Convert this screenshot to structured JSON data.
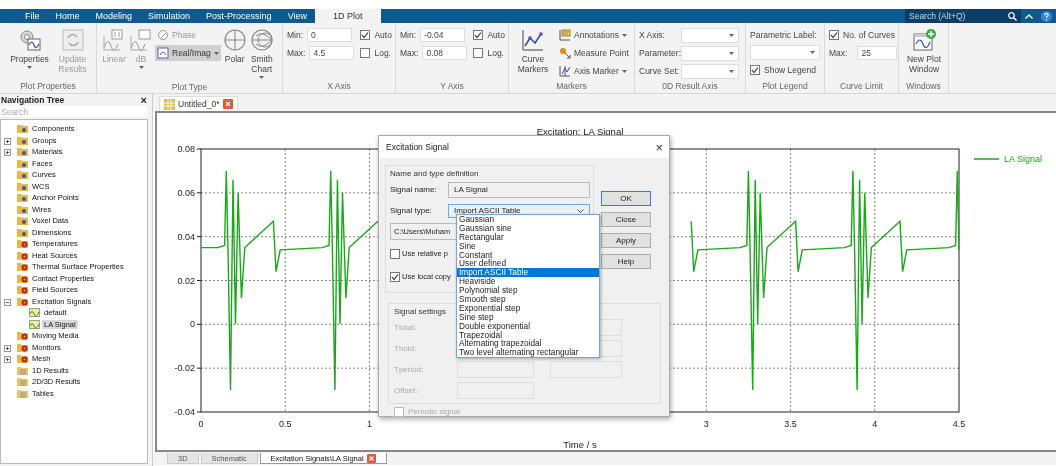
{
  "menu_tabs": [
    {
      "label": "File",
      "selected": false
    },
    {
      "label": "Home",
      "selected": false
    },
    {
      "label": "Modeling",
      "selected": false
    },
    {
      "label": "Simulation",
      "selected": false
    },
    {
      "label": "Post-Processing",
      "selected": false
    },
    {
      "label": "View",
      "selected": false
    },
    {
      "label": "1D Plot",
      "selected": true
    }
  ],
  "search": {
    "placeholder": "Search (Alt+Q)"
  },
  "ribbon": {
    "plot_properties": {
      "label": "Plot Properties",
      "buttons": [
        {
          "label": "Properties",
          "disabled": false,
          "menu": true
        },
        {
          "label": "Update Results",
          "disabled": true,
          "menu": false
        }
      ]
    },
    "plot_type": {
      "label": "Plot Type",
      "buttons": [
        {
          "kind": "large",
          "label": "Linear",
          "selected": false,
          "menu": false
        },
        {
          "kind": "large",
          "label": "dB",
          "selected": false,
          "menu": true
        },
        {
          "kind": "small",
          "label": "Phase",
          "selected": false,
          "menu": false
        },
        {
          "kind": "small",
          "label": "Real/Imag",
          "selected": true,
          "menu": true
        },
        {
          "kind": "large",
          "label": "Polar",
          "selected": false,
          "menu": false
        },
        {
          "kind": "large",
          "label": "Smith Chart",
          "selected": false,
          "menu": true
        }
      ]
    },
    "x_axis": {
      "label": "X Axis",
      "min_label": "Min:",
      "min": "0",
      "max_label": "Max:",
      "max": "4.5",
      "auto": {
        "label": "Auto",
        "checked": true
      },
      "log": {
        "label": "Log.",
        "checked": false
      }
    },
    "y_axis": {
      "label": "Y Axis",
      "min_label": "Min:",
      "min": "-0.04",
      "max_label": "Max:",
      "max": "0.08",
      "auto": {
        "label": "Auto",
        "checked": true
      },
      "log": {
        "label": "Log.",
        "checked": false
      }
    },
    "markers": {
      "label": "Markers",
      "curve_markers": "Curve Markers",
      "items": [
        {
          "label": "Annotations",
          "menu": true
        },
        {
          "label": "Measure Point",
          "menu": false
        },
        {
          "label": "Axis Marker",
          "menu": true
        }
      ]
    },
    "result_axis": {
      "label": "0D Result Axis",
      "fields": [
        "X Axis:",
        "Parameter:",
        "Curve Set:"
      ]
    },
    "plot_legend": {
      "label": "Plot Legend",
      "parametric_label": "Parametric Label:",
      "show_legend": {
        "label": "Show Legend",
        "checked": true
      }
    },
    "curve_limit": {
      "label": "Curve Limit",
      "no_of_curves": {
        "label": "No. of Curves",
        "checked": true
      },
      "max_label": "Max:",
      "max": "25"
    },
    "windows": {
      "label": "Windows",
      "new_plot": "New Plot Window"
    }
  },
  "navigation": {
    "title": "Navigation Tree",
    "close": "×",
    "search_placeholder": "Search",
    "tree": [
      {
        "label": "Components",
        "kind": "folder",
        "selected": false
      },
      {
        "label": "Groups",
        "kind": "folder",
        "expanded": false,
        "selected": false
      },
      {
        "label": "Materials",
        "kind": "folder",
        "expanded": false,
        "selected": false
      },
      {
        "label": "Faces",
        "kind": "folder",
        "selected": false
      },
      {
        "label": "Curves",
        "kind": "folder",
        "selected": false
      },
      {
        "label": "WCS",
        "kind": "folder",
        "selected": false
      },
      {
        "label": "Anchor Points",
        "kind": "folder",
        "selected": false
      },
      {
        "label": "Wires",
        "kind": "folder",
        "selected": false
      },
      {
        "label": "Voxel Data",
        "kind": "folder",
        "selected": false
      },
      {
        "label": "Dimensions",
        "kind": "folder",
        "selected": false
      },
      {
        "label": "Temperatures",
        "kind": "gear-folder",
        "selected": false
      },
      {
        "label": "Heat Sources",
        "kind": "gear-folder",
        "selected": false
      },
      {
        "label": "Thermal Surface Properties",
        "kind": "gear-folder",
        "selected": false
      },
      {
        "label": "Contact Properties",
        "kind": "gear-folder",
        "selected": false
      },
      {
        "label": "Field Sources",
        "kind": "gear-folder",
        "selected": false
      },
      {
        "label": "Excitation Signals",
        "kind": "gear-folder",
        "expanded": true,
        "selected": false,
        "children": [
          {
            "label": "default",
            "kind": "signal",
            "selected": false
          },
          {
            "label": "LA Signal",
            "kind": "signal",
            "selected": true
          }
        ]
      },
      {
        "label": "Moving Media",
        "kind": "gear-folder",
        "selected": false
      },
      {
        "label": "Monitors",
        "kind": "gear-folder",
        "expanded": false,
        "selected": false
      },
      {
        "label": "Mesh",
        "kind": "gear-folder",
        "expanded": false,
        "selected": false
      },
      {
        "label": "1D Results",
        "kind": "results",
        "selected": false
      },
      {
        "label": "2D/3D Results",
        "kind": "results",
        "selected": false
      },
      {
        "label": "Tables",
        "kind": "results",
        "selected": false
      }
    ]
  },
  "document_tabs": [
    {
      "label": "Untitled_0*",
      "selected": true
    }
  ],
  "plot": {
    "chart_data": {
      "type": "line",
      "title": "Excitation: LA Signal",
      "xlabel": "Time / s",
      "xlim": [
        0,
        4.5
      ],
      "ylim": [
        -0.04,
        0.08
      ],
      "xticks": [
        0,
        0.5,
        1,
        3,
        3.5,
        4,
        4.5
      ],
      "yticks": [
        0.08,
        0.06,
        0.04,
        0.02,
        0,
        -0.02,
        -0.04
      ],
      "x": [
        0,
        0.1,
        0.14,
        0.15,
        0.16,
        0.175,
        0.19,
        0.205,
        0.22,
        0.24,
        0.26,
        0.43,
        0.445,
        0.47,
        0.72,
        0.76,
        0.77,
        0.78,
        0.795,
        0.81,
        0.825,
        0.84,
        0.86,
        0.88,
        1.05,
        1.065,
        1.09,
        1.34,
        1.38,
        1.39,
        1.4,
        1.415,
        1.43,
        1.445,
        1.46,
        1.48,
        1.5,
        1.67,
        1.685,
        1.71,
        1.96,
        2.0,
        2.01,
        2.02,
        2.035,
        2.05,
        2.065,
        2.08,
        2.1,
        2.12,
        2.29,
        2.305,
        2.33,
        2.58,
        2.62,
        2.63,
        2.64,
        2.655,
        2.67,
        2.685,
        2.7,
        2.72,
        2.74,
        2.91,
        2.925,
        2.95,
        3.2,
        3.24,
        3.25,
        3.26,
        3.275,
        3.29,
        3.305,
        3.32,
        3.34,
        3.36,
        3.53,
        3.545,
        3.57,
        3.82,
        3.86,
        3.87,
        3.88,
        3.895,
        3.91,
        3.925,
        3.94,
        3.96,
        3.98,
        4.15,
        4.165,
        4.19,
        4.44,
        4.48,
        4.49,
        4.5
      ],
      "series": [
        {
          "name": "LA Signal",
          "color": "#1aa81a",
          "values": [
            0.035,
            0.035,
            0.036,
            0.07,
            0.034,
            -0.03,
            0.066,
            0,
            0.06,
            0.012,
            0.035,
            0.047,
            0.024,
            0.034,
            0.035,
            0.036,
            0.07,
            0.034,
            -0.03,
            0.066,
            0,
            0.06,
            0.012,
            0.035,
            0.047,
            null,
            null,
            null,
            null,
            null,
            null,
            null,
            null,
            null,
            null,
            null,
            null,
            null,
            null,
            null,
            null,
            null,
            null,
            null,
            null,
            null,
            null,
            null,
            null,
            null,
            null,
            null,
            null,
            null,
            null,
            null,
            null,
            null,
            null,
            null,
            null,
            null,
            null,
            0.047,
            0.024,
            0.034,
            0.035,
            0.036,
            0.07,
            0.034,
            -0.03,
            0.066,
            0,
            0.06,
            0.012,
            0.035,
            0.047,
            0.024,
            0.034,
            0.035,
            0.036,
            0.07,
            0.034,
            -0.03,
            0.066,
            0,
            0.06,
            0.012,
            0.035,
            0.047,
            0.024,
            0.034,
            0.035,
            0.036,
            0.07,
            0.034
          ]
        }
      ],
      "grid": true
    }
  },
  "dialog": {
    "title": "Excitation Signal",
    "close": "×",
    "group": "Name and type definition",
    "signal_name_label": "Signal name:",
    "signal_name": "LA Signal",
    "signal_type_label": "Signal type:",
    "signal_type": "Import ASCII Table",
    "path": "C:\\Users\\Muham",
    "checks": [
      {
        "label": "Use relative p",
        "checked": false
      },
      {
        "label": "Use local copy",
        "checked": true
      }
    ],
    "buttons": [
      {
        "label": "OK",
        "default": true
      },
      {
        "label": "Close",
        "default": false
      },
      {
        "label": "Apply",
        "default": false
      },
      {
        "label": "Help",
        "default": false
      }
    ],
    "settings_group": "Signal settings",
    "settings": [
      "Ttotal:",
      "Thold:",
      "Tperiod:",
      "Offset:"
    ],
    "periodic": {
      "label": "Periodic signal",
      "checked": false,
      "disabled": true
    },
    "options": [
      {
        "label": "Gaussian",
        "selected": false
      },
      {
        "label": "Gaussian sine",
        "selected": false
      },
      {
        "label": "Rectangular",
        "selected": false
      },
      {
        "label": "Sine",
        "selected": false
      },
      {
        "label": "Constant",
        "selected": false
      },
      {
        "label": "User defined",
        "selected": false
      },
      {
        "label": "Import ASCII Table",
        "selected": true
      },
      {
        "label": "Heaviside",
        "selected": false
      },
      {
        "label": "Polynomial step",
        "selected": false
      },
      {
        "label": "Smooth step",
        "selected": false
      },
      {
        "label": "Exponential step",
        "selected": false
      },
      {
        "label": "Sine step",
        "selected": false
      },
      {
        "label": "Double exponential",
        "selected": false
      },
      {
        "label": "Trapezoidal",
        "selected": false
      },
      {
        "label": "Alternating trapezoidal",
        "selected": false
      },
      {
        "label": "Two level alternating rectangular",
        "selected": false
      }
    ]
  },
  "bottom_tabs": [
    {
      "label": "3D",
      "selected": false,
      "closable": false
    },
    {
      "label": "Schematic",
      "selected": false,
      "closable": false
    },
    {
      "label": "Excitation Signals\\LA Signal",
      "selected": true,
      "closable": true
    }
  ]
}
